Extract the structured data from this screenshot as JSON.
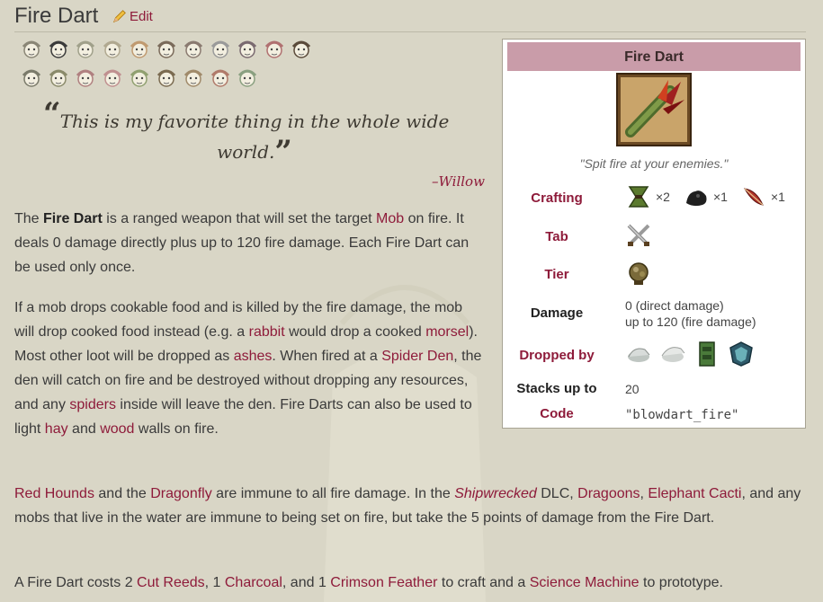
{
  "page": {
    "title": "Fire Dart",
    "edit_label": "Edit"
  },
  "quote": {
    "line1": "This is my favorite thing in the whole wide",
    "line2": "world.",
    "author": "–Willow"
  },
  "paragraphs": {
    "p1": {
      "t1": "The ",
      "bold": "Fire Dart",
      "t2": " is a ranged weapon that will set the target ",
      "l1": "Mob",
      "t3": " on fire. It deals 0 damage directly plus up to 120 fire damage. Each Fire Dart can be used only once."
    },
    "p2": {
      "t1": "If a mob drops cookable food and is killed by the fire damage, the mob will drop cooked food instead (e.g. a ",
      "l1": "rabbit",
      "t2": " would drop a cooked ",
      "l2": "morsel",
      "t3": "). Most other loot will be dropped as ",
      "l3": "ashes",
      "t4": ". When fired at a ",
      "l4": "Spider Den",
      "t5": ", the den will catch on fire and be destroyed without dropping any resources, and any ",
      "l5": "spiders",
      "t6": " inside will leave the den. Fire Darts can also be used to light ",
      "l6": "hay",
      "t7": " and ",
      "l7": "wood",
      "t8": " walls on fire."
    },
    "p3": {
      "l1": "Red Hounds",
      "t1": " and the ",
      "l2": "Dragonfly",
      "t2": " are immune to all fire damage. In the ",
      "l3": "Shipwrecked",
      "t3": " DLC, ",
      "l4": "Dragoons",
      "t4": ", ",
      "l5": "Elephant Cacti",
      "t5": ", and any mobs that live in the water are immune to being set on fire, but take the 5 points of damage from the Fire Dart."
    },
    "p4": {
      "t1": "A Fire Dart costs 2 ",
      "l1": "Cut Reeds",
      "t2": ", 1 ",
      "l2": "Charcoal",
      "t3": ", and 1 ",
      "l3": "Crimson Feather",
      "t4": " to craft and a ",
      "l4": "Science Machine",
      "t5": " to prototype."
    }
  },
  "infobox": {
    "title": "Fire Dart",
    "tagline": "\"Spit fire at your enemies.\"",
    "crafting_label": "Crafting",
    "crafting_items": [
      {
        "icon": "cut-reeds-icon",
        "qty": "×2"
      },
      {
        "icon": "charcoal-icon",
        "qty": "×1"
      },
      {
        "icon": "crimson-feather-icon",
        "qty": "×1"
      }
    ],
    "tab_label": "Tab",
    "tier_label": "Tier",
    "damage_label": "Damage",
    "damage_line1": "0 (direct damage)",
    "damage_line2": "up to 120 (fire damage)",
    "dropped_by_label": "Dropped by",
    "stacks_label": "Stacks up to",
    "stacks_value": "20",
    "code_label": "Code",
    "code_value": "\"blowdart_fire\""
  },
  "colors": {
    "link": "#8e1b3a",
    "header_bg": "#c99ca9",
    "page_bg": "#d9d6c6"
  }
}
